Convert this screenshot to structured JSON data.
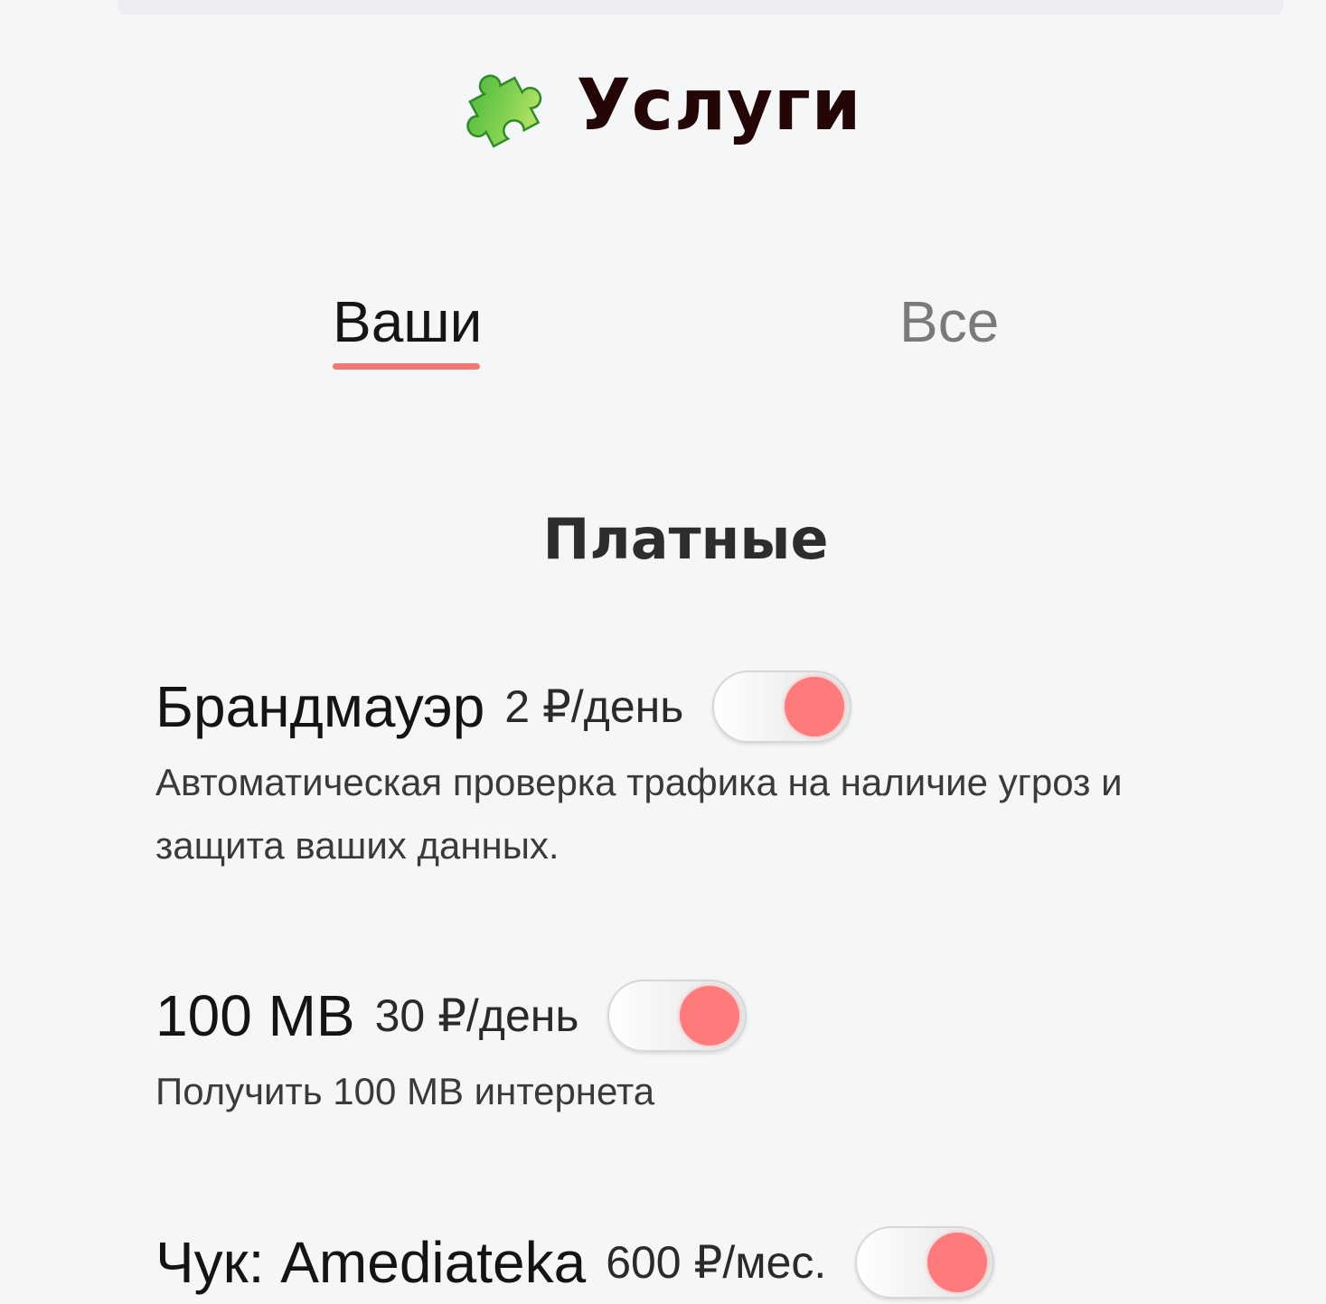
{
  "header": {
    "icon": "puzzle-piece-icon",
    "title": "Услуги"
  },
  "tabs": {
    "yours": "Ваши",
    "all": "Все",
    "active": "yours"
  },
  "section": {
    "title": "Платные"
  },
  "services": [
    {
      "name": "Брандмауэр",
      "price": "2 ₽/день",
      "description": "Автоматическая проверка трафика на наличие угроз и защита ваших данных.",
      "enabled": true
    },
    {
      "name": "100 MB",
      "price": "30 ₽/день",
      "description": "Получить 100 MB интернета",
      "enabled": true
    },
    {
      "name": "Чук: Amediateka",
      "price": "600 ₽/мес.",
      "description": "",
      "enabled": true
    }
  ],
  "colors": {
    "accent": "#f27771",
    "toggle_on": "#ff7b7b",
    "title": "#240606",
    "background": "#f5f6f8"
  }
}
